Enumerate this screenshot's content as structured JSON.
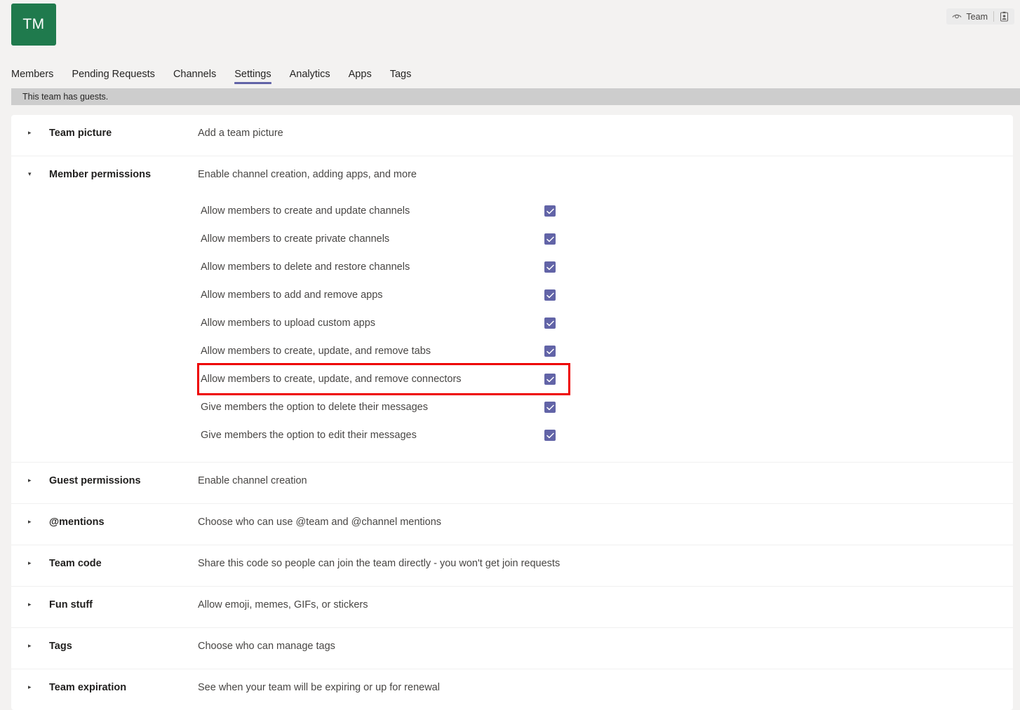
{
  "header": {
    "team_initials": "TM",
    "team_pill_label": "Team",
    "eye_icon": "eye-icon",
    "badge_icon": "person-badge-icon"
  },
  "tabs": [
    {
      "label": "Members",
      "active": false
    },
    {
      "label": "Pending Requests",
      "active": false
    },
    {
      "label": "Channels",
      "active": false
    },
    {
      "label": "Settings",
      "active": true
    },
    {
      "label": "Analytics",
      "active": false
    },
    {
      "label": "Apps",
      "active": false
    },
    {
      "label": "Tags",
      "active": false
    }
  ],
  "banner": {
    "text": "This team has guests."
  },
  "sections": [
    {
      "title": "Team picture",
      "description": "Add a team picture",
      "expanded": false,
      "chevron": "▸"
    },
    {
      "title": "Member permissions",
      "description": "Enable channel creation, adding apps, and more",
      "expanded": true,
      "chevron": "▾",
      "options": [
        {
          "label": "Allow members to create and update channels",
          "checked": true,
          "highlighted": false
        },
        {
          "label": "Allow members to create private channels",
          "checked": true,
          "highlighted": false
        },
        {
          "label": "Allow members to delete and restore channels",
          "checked": true,
          "highlighted": false
        },
        {
          "label": "Allow members to add and remove apps",
          "checked": true,
          "highlighted": false
        },
        {
          "label": "Allow members to upload custom apps",
          "checked": true,
          "highlighted": false
        },
        {
          "label": "Allow members to create, update, and remove tabs",
          "checked": true,
          "highlighted": false
        },
        {
          "label": "Allow members to create, update, and remove connectors",
          "checked": true,
          "highlighted": true
        },
        {
          "label": "Give members the option to delete their messages",
          "checked": true,
          "highlighted": false
        },
        {
          "label": "Give members the option to edit their messages",
          "checked": true,
          "highlighted": false
        }
      ]
    },
    {
      "title": "Guest permissions",
      "description": "Enable channel creation",
      "expanded": false,
      "chevron": "▸"
    },
    {
      "title": "@mentions",
      "description": "Choose who can use @team and @channel mentions",
      "expanded": false,
      "chevron": "▸"
    },
    {
      "title": "Team code",
      "description": "Share this code so people can join the team directly - you won't get join requests",
      "expanded": false,
      "chevron": "▸"
    },
    {
      "title": "Fun stuff",
      "description": "Allow emoji, memes, GIFs, or stickers",
      "expanded": false,
      "chevron": "▸"
    },
    {
      "title": "Tags",
      "description": "Choose who can manage tags",
      "expanded": false,
      "chevron": "▸"
    },
    {
      "title": "Team expiration",
      "description": "See when your team will be expiring or up for renewal",
      "expanded": false,
      "chevron": "▸"
    }
  ],
  "colors": {
    "avatar_green": "#1f7a4d",
    "accent_purple": "#6264a7",
    "highlight_red": "#ee0000",
    "banner_gray": "#cdcdcd",
    "page_bg": "#f3f2f1"
  }
}
